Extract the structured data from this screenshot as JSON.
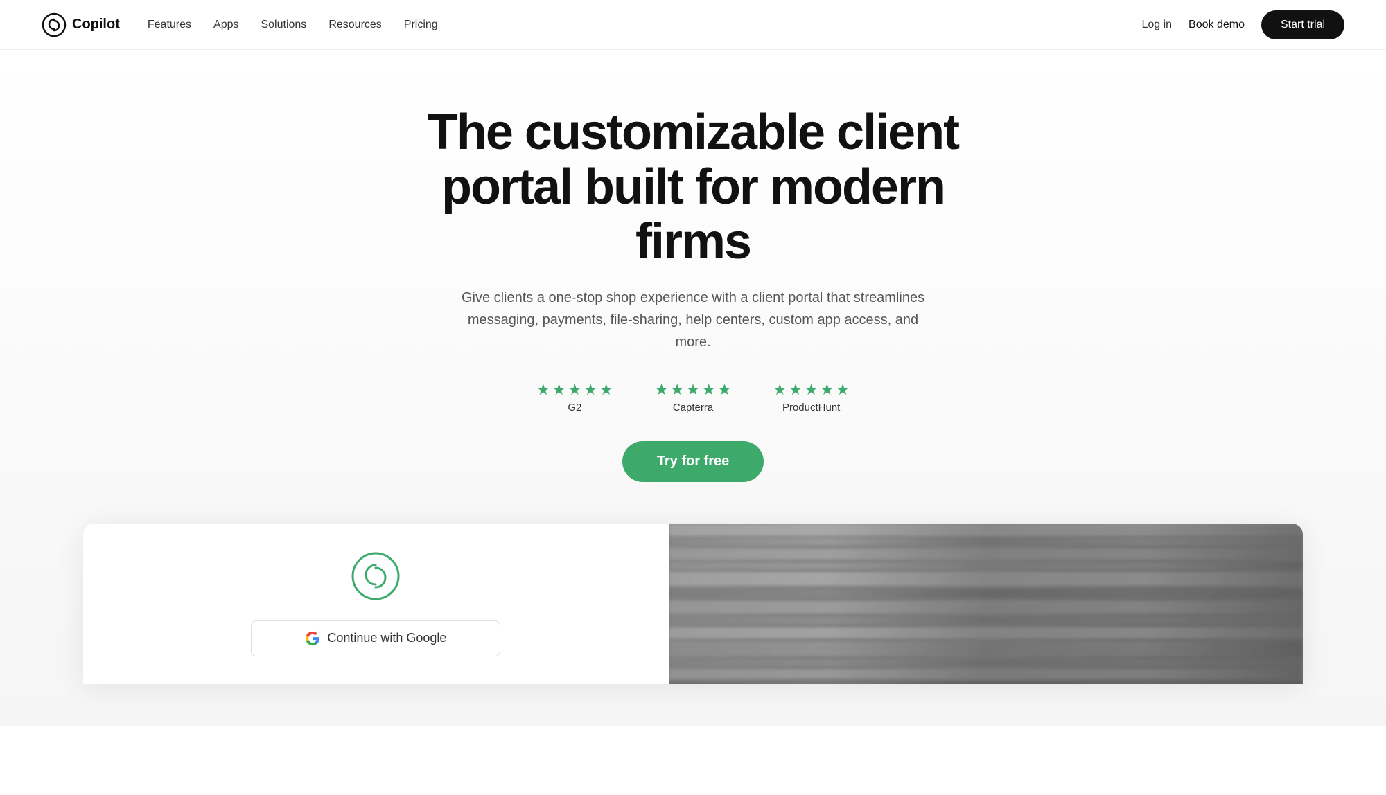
{
  "logo": {
    "text": "Copilot",
    "icon_label": "copilot-logo-icon"
  },
  "nav": {
    "links": [
      {
        "label": "Features",
        "id": "features"
      },
      {
        "label": "Apps",
        "id": "apps"
      },
      {
        "label": "Solutions",
        "id": "solutions"
      },
      {
        "label": "Resources",
        "id": "resources"
      },
      {
        "label": "Pricing",
        "id": "pricing"
      }
    ],
    "login_label": "Log in",
    "book_demo_label": "Book demo",
    "start_trial_label": "Start trial"
  },
  "hero": {
    "title": "The customizable client portal built for modern firms",
    "subtitle": "Give clients a one-stop shop experience with a client portal that streamlines messaging, payments, file-sharing, help centers, custom app access, and more.",
    "cta_label": "Try for free",
    "ratings": [
      {
        "platform": "G2",
        "stars": 5
      },
      {
        "platform": "Capterra",
        "stars": 5
      },
      {
        "platform": "ProductHunt",
        "stars": 5
      }
    ]
  },
  "preview": {
    "continue_google_label": "Continue with Google",
    "google_icon_label": "google-icon"
  },
  "colors": {
    "star": "#3daa6c",
    "cta_green": "#3daa6c",
    "nav_bg": "#ffffff",
    "hero_bg": "#f5f5f5",
    "start_trial_bg": "#111111",
    "text_primary": "#111111",
    "text_secondary": "#555555"
  }
}
